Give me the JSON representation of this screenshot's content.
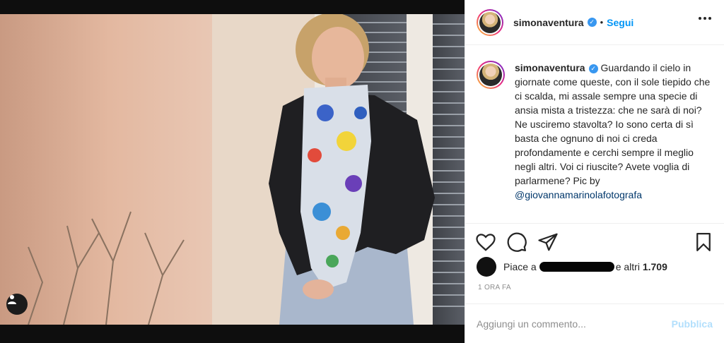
{
  "post": {
    "username": "simonaventura",
    "follow_label": "Segui",
    "separator": "•",
    "caption_lines": [
      "Guardando il cielo",
      "in giornate come queste, con il sole",
      "tiepido che ci scalda, mi assale sempre",
      "una specie di ansia mista a tristezza:",
      "che ne sarà di noi? Ne usciremo",
      "stavolta? Io sono certa di sì basta che",
      "ognuno di noi ci creda profondamente",
      "e cerchi sempre il meglio negli altri.",
      "Voi ci riuscite? Avete voglia di",
      "parlarmene? Pic by"
    ],
    "mention": "@giovannamarinolafotografa",
    "likes_prefix": "Piace a",
    "likes_suffix": "e altri",
    "likes_count": "1.709",
    "timestamp": "1 ORA FA",
    "comment_placeholder": "Aggiungi un commento...",
    "publish_label": "Pubblica"
  },
  "icons": {
    "verified": "verified-badge-icon",
    "like": "heart-icon",
    "comment": "comment-icon",
    "share": "paper-plane-icon",
    "save": "bookmark-icon",
    "more": "more-options-icon",
    "user_tag": "user-tag-icon"
  },
  "colors": {
    "accent": "#0095f6",
    "verified": "#3897f0",
    "publish_disabled": "#b2dffc",
    "muted": "#8e8e8e"
  }
}
